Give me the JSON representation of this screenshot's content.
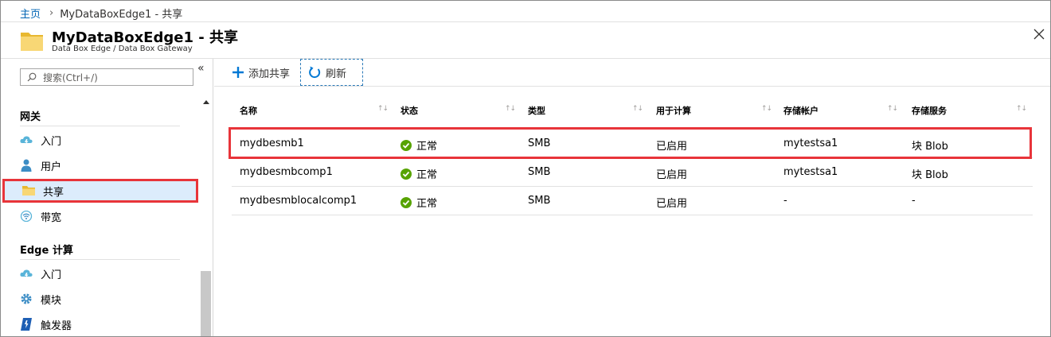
{
  "breadcrumb": {
    "home": "主页",
    "current": "MyDataBoxEdge1 - 共享"
  },
  "header": {
    "title": "MyDataBoxEdge1 - 共享",
    "subtitle": "Data Box Edge / Data Box Gateway"
  },
  "search": {
    "placeholder": "搜索(Ctrl+/)"
  },
  "sidebar": {
    "sections": [
      {
        "title": "网关",
        "items": [
          {
            "label": "入门",
            "icon": "cloud-lightning-icon"
          },
          {
            "label": "用户",
            "icon": "user-icon"
          },
          {
            "label": "共享",
            "icon": "folder-icon",
            "active": true
          },
          {
            "label": "带宽",
            "icon": "wifi-icon"
          }
        ]
      },
      {
        "title": "Edge 计算",
        "items": [
          {
            "label": "入门",
            "icon": "cloud-lightning-icon"
          },
          {
            "label": "模块",
            "icon": "gear-icon"
          },
          {
            "label": "触发器",
            "icon": "trigger-icon"
          }
        ]
      }
    ]
  },
  "toolbar": {
    "add_label": "添加共享",
    "refresh_label": "刷新"
  },
  "grid": {
    "columns": [
      "名称",
      "状态",
      "类型",
      "用于计算",
      "存储帐户",
      "存储服务"
    ],
    "rows": [
      {
        "name": "mydbesmb1",
        "status": "正常",
        "type": "SMB",
        "compute": "已启用",
        "account": "mytestsa1",
        "service": "块 Blob",
        "highlighted": true
      },
      {
        "name": "mydbesmbcomp1",
        "status": "正常",
        "type": "SMB",
        "compute": "已启用",
        "account": "mytestsa1",
        "service": "块 Blob"
      },
      {
        "name": "mydbesmblocalcomp1",
        "status": "正常",
        "type": "SMB",
        "compute": "已启用",
        "account": "-",
        "service": "-"
      }
    ]
  },
  "colors": {
    "accent": "#0078d4",
    "highlight": "#e8343a",
    "status_ok": "#57a300",
    "folder": "#f8d775"
  }
}
